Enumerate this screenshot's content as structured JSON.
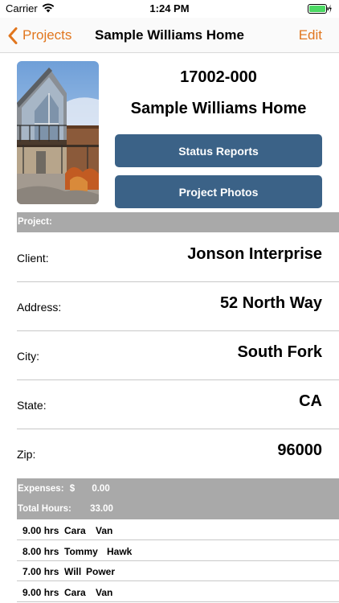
{
  "status_bar": {
    "carrier": "Carrier",
    "time": "1:24 PM"
  },
  "nav": {
    "back_label": "Projects",
    "title": "Sample Williams Home",
    "edit_label": "Edit"
  },
  "project": {
    "number": "17002-000",
    "name": "Sample Williams Home"
  },
  "buttons": {
    "status_reports": "Status Reports",
    "project_photos": "Project Photos"
  },
  "project_section": {
    "title": "Project:"
  },
  "fields": [
    {
      "label": "Client:",
      "value": "Jonson Interprise"
    },
    {
      "label": "Address:",
      "value": "52 North Way"
    },
    {
      "label": "City:",
      "value": "South Fork"
    },
    {
      "label": "State:",
      "value": "CA"
    },
    {
      "label": "Zip:",
      "value": "96000"
    }
  ],
  "summary": {
    "expenses_label": "Expenses:",
    "currency": "$",
    "expenses_value": "0.00",
    "hours_label": "Total Hours:",
    "hours_value": "33.00"
  },
  "hours": [
    {
      "hours": "9.00 hrs",
      "first": "Cara",
      "last": "Van"
    },
    {
      "hours": "8.00 hrs",
      "first": "Tommy",
      "last": "Hawk"
    },
    {
      "hours": "7.00 hrs",
      "first": "Will",
      "last": "Power"
    },
    {
      "hours": "9.00 hrs",
      "first": "Cara",
      "last": "Van"
    }
  ],
  "colors": {
    "accent": "#e1761e",
    "button": "#3b6287",
    "section_header": "#a9a9a9",
    "battery": "#4cd964"
  }
}
